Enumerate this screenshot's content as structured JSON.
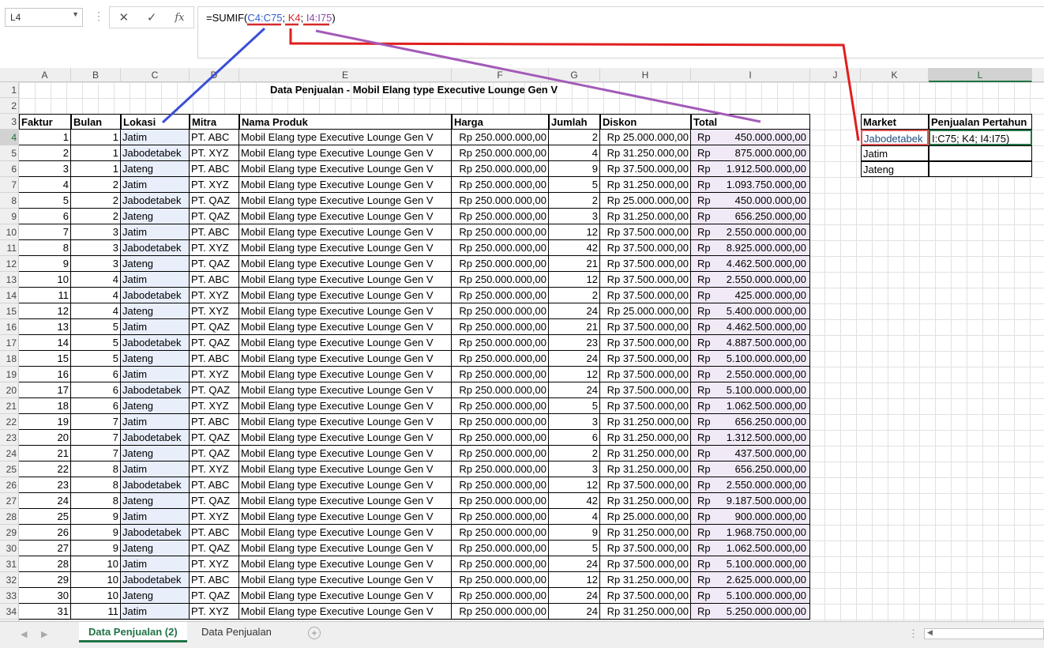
{
  "name_box": "L4",
  "formula": {
    "prefix": "=SUMIF(",
    "range": "C4:C75",
    "sep1": "; ",
    "criteria": "K4",
    "sep2": "; ",
    "sum_range": "I4:I75",
    "suffix": ")"
  },
  "columns": [
    "A",
    "B",
    "C",
    "D",
    "E",
    "F",
    "G",
    "H",
    "I",
    "J",
    "K",
    "L"
  ],
  "rows_visible": [
    "1",
    "2",
    "3",
    "4",
    "5",
    "6",
    "7",
    "8",
    "9",
    "10",
    "11",
    "12",
    "13",
    "14",
    "15",
    "16",
    "17",
    "18",
    "19",
    "20",
    "21",
    "22",
    "23",
    "24",
    "25",
    "26",
    "27",
    "28",
    "29",
    "30",
    "31",
    "32",
    "33",
    "34"
  ],
  "title": "Data Penjualan - Mobil Elang type Executive Lounge Gen V",
  "headers": [
    "Faktur",
    "Bulan",
    "Lokasi",
    "Mitra",
    "Nama Produk",
    "Harga",
    "Jumlah",
    "Diskon",
    "Total"
  ],
  "rows": [
    [
      "1",
      "1",
      "Jatim",
      "PT. ABC",
      "Mobil Elang type Executive Lounge Gen V",
      "Rp 250.000.000,00",
      "2",
      "Rp 25.000.000,00",
      "Rp",
      "450.000.000,00"
    ],
    [
      "2",
      "1",
      "Jabodetabek",
      "PT. XYZ",
      "Mobil Elang type Executive Lounge Gen V",
      "Rp 250.000.000,00",
      "4",
      "Rp 31.250.000,00",
      "Rp",
      "875.000.000,00"
    ],
    [
      "3",
      "1",
      "Jateng",
      "PT. ABC",
      "Mobil Elang type Executive Lounge Gen V",
      "Rp 250.000.000,00",
      "9",
      "Rp 37.500.000,00",
      "Rp",
      "1.912.500.000,00"
    ],
    [
      "4",
      "2",
      "Jatim",
      "PT. XYZ",
      "Mobil Elang type Executive Lounge Gen V",
      "Rp 250.000.000,00",
      "5",
      "Rp 31.250.000,00",
      "Rp",
      "1.093.750.000,00"
    ],
    [
      "5",
      "2",
      "Jabodetabek",
      "PT. QAZ",
      "Mobil Elang type Executive Lounge Gen V",
      "Rp 250.000.000,00",
      "2",
      "Rp 25.000.000,00",
      "Rp",
      "450.000.000,00"
    ],
    [
      "6",
      "2",
      "Jateng",
      "PT. QAZ",
      "Mobil Elang type Executive Lounge Gen V",
      "Rp 250.000.000,00",
      "3",
      "Rp 31.250.000,00",
      "Rp",
      "656.250.000,00"
    ],
    [
      "7",
      "3",
      "Jatim",
      "PT. ABC",
      "Mobil Elang type Executive Lounge Gen V",
      "Rp 250.000.000,00",
      "12",
      "Rp 37.500.000,00",
      "Rp",
      "2.550.000.000,00"
    ],
    [
      "8",
      "3",
      "Jabodetabek",
      "PT. XYZ",
      "Mobil Elang type Executive Lounge Gen V",
      "Rp 250.000.000,00",
      "42",
      "Rp 37.500.000,00",
      "Rp",
      "8.925.000.000,00"
    ],
    [
      "9",
      "3",
      "Jateng",
      "PT. QAZ",
      "Mobil Elang type Executive Lounge Gen V",
      "Rp 250.000.000,00",
      "21",
      "Rp 37.500.000,00",
      "Rp",
      "4.462.500.000,00"
    ],
    [
      "10",
      "4",
      "Jatim",
      "PT. ABC",
      "Mobil Elang type Executive Lounge Gen V",
      "Rp 250.000.000,00",
      "12",
      "Rp 37.500.000,00",
      "Rp",
      "2.550.000.000,00"
    ],
    [
      "11",
      "4",
      "Jabodetabek",
      "PT. XYZ",
      "Mobil Elang type Executive Lounge Gen V",
      "Rp 250.000.000,00",
      "2",
      "Rp 37.500.000,00",
      "Rp",
      "425.000.000,00"
    ],
    [
      "12",
      "4",
      "Jateng",
      "PT. XYZ",
      "Mobil Elang type Executive Lounge Gen V",
      "Rp 250.000.000,00",
      "24",
      "Rp 25.000.000,00",
      "Rp",
      "5.400.000.000,00"
    ],
    [
      "13",
      "5",
      "Jatim",
      "PT. QAZ",
      "Mobil Elang type Executive Lounge Gen V",
      "Rp 250.000.000,00",
      "21",
      "Rp 37.500.000,00",
      "Rp",
      "4.462.500.000,00"
    ],
    [
      "14",
      "5",
      "Jabodetabek",
      "PT. QAZ",
      "Mobil Elang type Executive Lounge Gen V",
      "Rp 250.000.000,00",
      "23",
      "Rp 37.500.000,00",
      "Rp",
      "4.887.500.000,00"
    ],
    [
      "15",
      "5",
      "Jateng",
      "PT. ABC",
      "Mobil Elang type Executive Lounge Gen V",
      "Rp 250.000.000,00",
      "24",
      "Rp 37.500.000,00",
      "Rp",
      "5.100.000.000,00"
    ],
    [
      "16",
      "6",
      "Jatim",
      "PT. XYZ",
      "Mobil Elang type Executive Lounge Gen V",
      "Rp 250.000.000,00",
      "12",
      "Rp 37.500.000,00",
      "Rp",
      "2.550.000.000,00"
    ],
    [
      "17",
      "6",
      "Jabodetabek",
      "PT. QAZ",
      "Mobil Elang type Executive Lounge Gen V",
      "Rp 250.000.000,00",
      "24",
      "Rp 37.500.000,00",
      "Rp",
      "5.100.000.000,00"
    ],
    [
      "18",
      "6",
      "Jateng",
      "PT. XYZ",
      "Mobil Elang type Executive Lounge Gen V",
      "Rp 250.000.000,00",
      "5",
      "Rp 37.500.000,00",
      "Rp",
      "1.062.500.000,00"
    ],
    [
      "19",
      "7",
      "Jatim",
      "PT. ABC",
      "Mobil Elang type Executive Lounge Gen V",
      "Rp 250.000.000,00",
      "3",
      "Rp 31.250.000,00",
      "Rp",
      "656.250.000,00"
    ],
    [
      "20",
      "7",
      "Jabodetabek",
      "PT. QAZ",
      "Mobil Elang type Executive Lounge Gen V",
      "Rp 250.000.000,00",
      "6",
      "Rp 31.250.000,00",
      "Rp",
      "1.312.500.000,00"
    ],
    [
      "21",
      "7",
      "Jateng",
      "PT. QAZ",
      "Mobil Elang type Executive Lounge Gen V",
      "Rp 250.000.000,00",
      "2",
      "Rp 31.250.000,00",
      "Rp",
      "437.500.000,00"
    ],
    [
      "22",
      "8",
      "Jatim",
      "PT. XYZ",
      "Mobil Elang type Executive Lounge Gen V",
      "Rp 250.000.000,00",
      "3",
      "Rp 31.250.000,00",
      "Rp",
      "656.250.000,00"
    ],
    [
      "23",
      "8",
      "Jabodetabek",
      "PT. ABC",
      "Mobil Elang type Executive Lounge Gen V",
      "Rp 250.000.000,00",
      "12",
      "Rp 37.500.000,00",
      "Rp",
      "2.550.000.000,00"
    ],
    [
      "24",
      "8",
      "Jateng",
      "PT. QAZ",
      "Mobil Elang type Executive Lounge Gen V",
      "Rp 250.000.000,00",
      "42",
      "Rp 31.250.000,00",
      "Rp",
      "9.187.500.000,00"
    ],
    [
      "25",
      "9",
      "Jatim",
      "PT. XYZ",
      "Mobil Elang type Executive Lounge Gen V",
      "Rp 250.000.000,00",
      "4",
      "Rp 25.000.000,00",
      "Rp",
      "900.000.000,00"
    ],
    [
      "26",
      "9",
      "Jabodetabek",
      "PT. ABC",
      "Mobil Elang type Executive Lounge Gen V",
      "Rp 250.000.000,00",
      "9",
      "Rp 31.250.000,00",
      "Rp",
      "1.968.750.000,00"
    ],
    [
      "27",
      "9",
      "Jateng",
      "PT. QAZ",
      "Mobil Elang type Executive Lounge Gen V",
      "Rp 250.000.000,00",
      "5",
      "Rp 37.500.000,00",
      "Rp",
      "1.062.500.000,00"
    ],
    [
      "28",
      "10",
      "Jatim",
      "PT. XYZ",
      "Mobil Elang type Executive Lounge Gen V",
      "Rp 250.000.000,00",
      "24",
      "Rp 37.500.000,00",
      "Rp",
      "5.100.000.000,00"
    ],
    [
      "29",
      "10",
      "Jabodetabek",
      "PT. ABC",
      "Mobil Elang type Executive Lounge Gen V",
      "Rp 250.000.000,00",
      "12",
      "Rp 31.250.000,00",
      "Rp",
      "2.625.000.000,00"
    ],
    [
      "30",
      "10",
      "Jateng",
      "PT. QAZ",
      "Mobil Elang type Executive Lounge Gen V",
      "Rp 250.000.000,00",
      "24",
      "Rp 37.500.000,00",
      "Rp",
      "5.100.000.000,00"
    ],
    [
      "31",
      "11",
      "Jatim",
      "PT. XYZ",
      "Mobil Elang type Executive Lounge Gen V",
      "Rp 250.000.000,00",
      "24",
      "Rp 31.250.000,00",
      "Rp",
      "5.250.000.000,00"
    ]
  ],
  "side_table": {
    "header_market": "Market",
    "header_sales": "Penjualan Pertahun",
    "markets": [
      "Jabodetabek",
      "Jatim",
      "Jateng"
    ],
    "editing_text": "I:C75; K4; I4:I75)"
  },
  "sheet_tabs": [
    "Data Penjualan (2)",
    "Data Penjualan"
  ],
  "active_tab": "Data Penjualan (2)",
  "colors": {
    "accent": "#217346",
    "blue_ref": "#2f5fd0",
    "red_ref": "#d22a2a",
    "purple_ref": "#8d4ba8"
  }
}
